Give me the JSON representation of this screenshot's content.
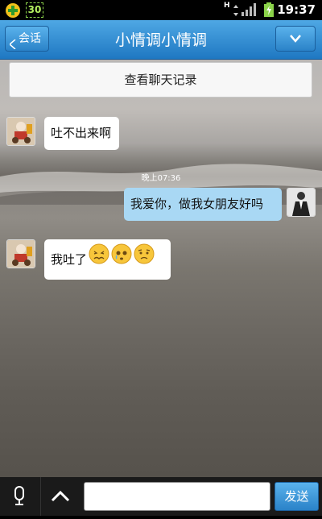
{
  "status_bar": {
    "notification_badge": "30",
    "network_type": "H",
    "time": "19:37"
  },
  "header": {
    "back_label": "会话",
    "title": "小情调小情调"
  },
  "chat": {
    "history_label": "查看聊天记录",
    "messages": [
      {
        "sender": "other",
        "text": "吐不出来啊"
      },
      {
        "sender": "me",
        "text": "我爱你，做我女朋友好吗"
      },
      {
        "sender": "other",
        "text": "我吐了",
        "emojis": [
          "sick-face-emoji",
          "crying-face-emoji",
          "worried-face-emoji"
        ]
      }
    ],
    "timestamp": "晚上07:36"
  },
  "input_bar": {
    "message_value": "",
    "send_label": "发送"
  },
  "colors": {
    "accent": "#2a82c8",
    "my_bubble": "#a9d8f4"
  }
}
